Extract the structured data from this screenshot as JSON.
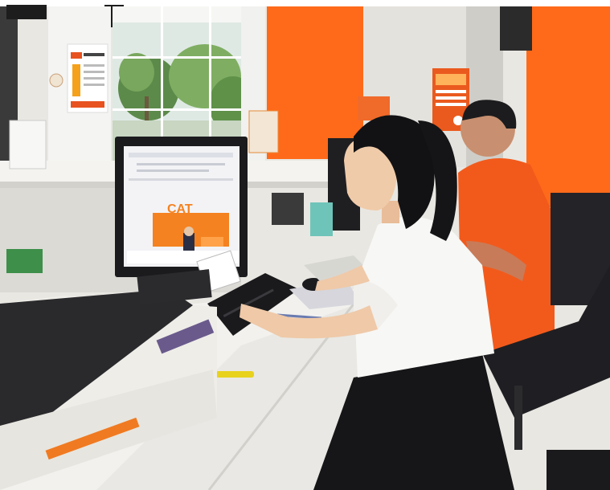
{
  "photo": {
    "subject": "office-service-counter",
    "monitor_logo": "CAT",
    "colors": {
      "orange_wall": "#ff6a1a",
      "brand_orange": "#f58220",
      "shirt_orange": "#f25a1c",
      "desk_white": "#f2f1ee",
      "skirt_black": "#161618",
      "blouse_white": "#f7f7f5"
    }
  }
}
